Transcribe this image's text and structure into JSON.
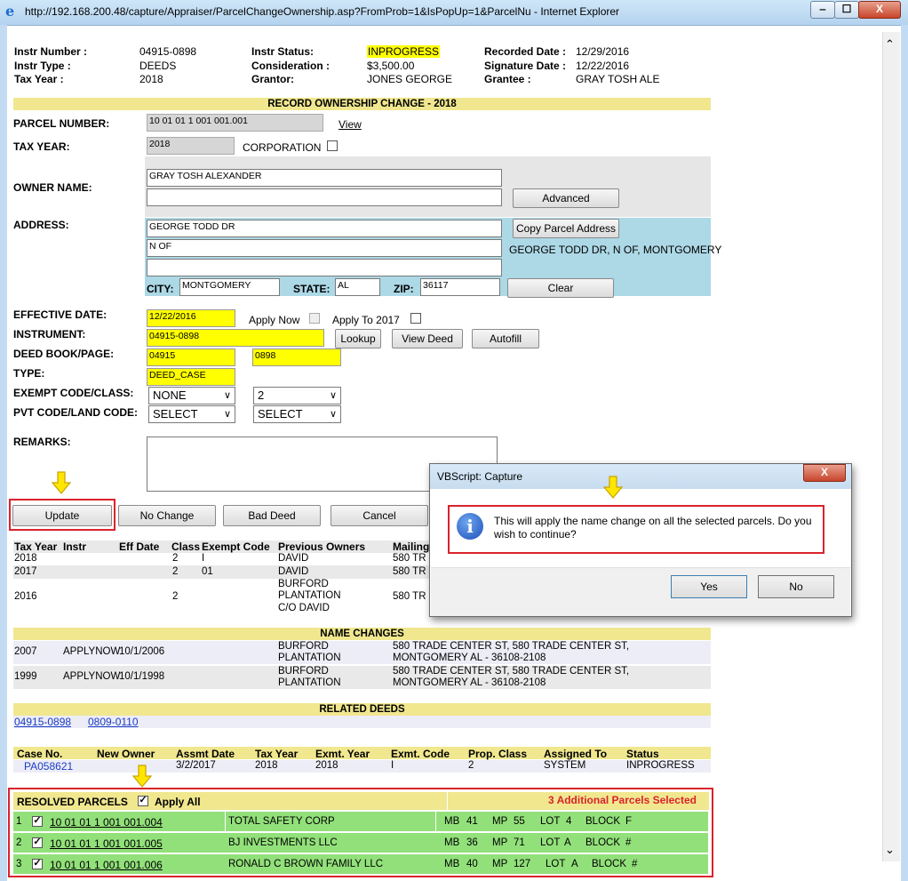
{
  "window": {
    "title": "http://192.168.200.48/capture/Appraiser/ParcelChangeOwnership.asp?FromProb=1&IsPopUp=1&ParcelNu - Internet Explorer",
    "min": "‒",
    "max": "☐",
    "close": "X"
  },
  "header": {
    "instr_number_label": "Instr Number :",
    "instr_number": "04915-0898",
    "instr_type_label": "Instr Type :",
    "instr_type": "DEEDS",
    "tax_year_label": "Tax Year :",
    "tax_year": "2018",
    "instr_status_label": "Instr Status:",
    "instr_status": "INPROGRESS",
    "consideration_label": "Consideration :",
    "consideration": "$3,500.00",
    "grantor_label": "Grantor:",
    "grantor": "JONES GEORGE",
    "recorded_date_label": "Recorded Date :",
    "recorded_date": "12/29/2016",
    "signature_date_label": "Signature Date :",
    "signature_date": "12/22/2016",
    "grantee_label": "Grantee :",
    "grantee": "GRAY TOSH ALE"
  },
  "record": {
    "title": "RECORD OWNERSHIP CHANGE   -   2018",
    "parcel_label": "PARCEL NUMBER:",
    "parcel": "10 01 01 1 001 001.001",
    "view": "View",
    "tax_year_label": "TAX YEAR:",
    "tax_year": "2018",
    "corporation": "CORPORATION",
    "owner_label": "OWNER NAME:",
    "owner1": "GRAY TOSH ALEXANDER",
    "owner2": "",
    "advanced": "Advanced",
    "address_label": "ADDRESS:",
    "addr1": "GEORGE TODD DR",
    "addr2": "N OF",
    "addr3": "",
    "copy_address": "Copy Parcel Address",
    "parcel_address": "GEORGE TODD DR, N OF, MONTGOMERY",
    "city_label": "CITY:",
    "city": "MONTGOMERY",
    "state_label": "STATE:",
    "state": "AL",
    "zip_label": "ZIP:",
    "zip": "36117",
    "clear": "Clear",
    "eff_label": "EFFECTIVE DATE:",
    "eff_date": "12/22/2016",
    "apply_now": "Apply Now",
    "apply_to": "Apply To 2017",
    "instr_label": "INSTRUMENT:",
    "instrument": "04915-0898",
    "lookup": "Lookup",
    "view_deed": "View Deed",
    "autofill": "Autofill",
    "deed_label": "DEED BOOK/PAGE:",
    "deed_book": "04915",
    "deed_page": "0898",
    "type_label": "TYPE:",
    "type": "DEED_CASE",
    "exempt_label": "EXEMPT CODE/CLASS:",
    "exempt_code": "NONE",
    "exempt_class": "2",
    "pvt_label": "PVT CODE/LAND CODE:",
    "pvt_code": "SELECT",
    "land_code": "SELECT",
    "remarks_label": "REMARKS:"
  },
  "actions": {
    "update": "Update",
    "no_change": "No Change",
    "bad_deed": "Bad Deed",
    "cancel": "Cancel"
  },
  "history": {
    "headers": [
      "Tax Year",
      "Instr",
      "Eff Date",
      "Class",
      "Exempt Code",
      "Previous Owners",
      "Mailing"
    ],
    "rows": [
      {
        "year": "2018",
        "class": "2",
        "exempt": "I",
        "owner": [
          "DAVID"
        ],
        "mail": "580 TR"
      },
      {
        "year": "2017",
        "class": "2",
        "exempt": "01",
        "owner": [
          "DAVID"
        ],
        "mail": "580 TR"
      },
      {
        "year": "2016",
        "class": "2",
        "exempt": "",
        "owner": [
          "BURFORD",
          "PLANTATION",
          "C/O DAVID"
        ],
        "mail": "580 TR"
      }
    ]
  },
  "name_changes": {
    "title": "NAME CHANGES",
    "rows": [
      {
        "year": "2007",
        "instr": "APPLYNOW",
        "date": "10/1/2006",
        "owner": [
          "BURFORD",
          "PLANTATION"
        ],
        "addr": [
          "580 TRADE CENTER ST, 580 TRADE CENTER ST,",
          "MONTGOMERY AL -  36108-2108"
        ]
      },
      {
        "year": "1999",
        "instr": "APPLYNOW",
        "date": "10/1/1998",
        "owner": [
          "BURFORD",
          "PLANTATION"
        ],
        "addr": [
          "580 TRADE CENTER ST, 580 TRADE CENTER ST,",
          "MONTGOMERY AL -  36108-2108"
        ]
      }
    ]
  },
  "related": {
    "title": "RELATED DEEDS",
    "deed1": "04915-0898",
    "deed2": "0809-0110"
  },
  "cases": {
    "headers": [
      "Case No.",
      "New Owner",
      "Assmt Date",
      "Tax Year",
      "Exmt. Year",
      "Exmt. Code",
      "Prop. Class",
      "Assigned To",
      "Status"
    ],
    "row": [
      "PA058621",
      "",
      "3/2/2017",
      "2018",
      "2018",
      "I",
      "2",
      "SYSTEM",
      "INPROGRESS"
    ]
  },
  "resolved": {
    "title": "RESOLVED PARCELS",
    "apply_all": "Apply All",
    "selected": "3 Additional Parcels Selected",
    "rows": [
      {
        "n": "1",
        "parcel": "10 01 01 1 001 001.004",
        "owner": "TOTAL SAFETY CORP",
        "mb": "41",
        "mp": "55",
        "lot": "4",
        "block": "F"
      },
      {
        "n": "2",
        "parcel": "10 01 01 1 001 001.005",
        "owner": "BJ INVESTMENTS LLC",
        "mb": "36",
        "mp": "71",
        "lot": "A",
        "block": "#"
      },
      {
        "n": "3",
        "parcel": "10 01 01 1 001 001.006",
        "owner": "RONALD C BROWN FAMILY LLC",
        "mb": "40",
        "mp": "127",
        "lot": "A",
        "block": "#"
      }
    ],
    "mb_label": "MB",
    "mp_label": "MP",
    "lot_label": "LOT",
    "block_label": "BLOCK"
  },
  "dialog": {
    "title": "VBScript: Capture",
    "close": "X",
    "message_line1": "This will apply the name change on all the selected parcels. Do you",
    "message_line2": "wish to continue?",
    "yes": "Yes",
    "no": "No"
  },
  "colors": {
    "highlight": "#ffff00",
    "section_bar": "#f0e78f",
    "resolved_row": "#92e07a",
    "annotation_red": "#d9232b",
    "arrow": "#ffe600"
  }
}
